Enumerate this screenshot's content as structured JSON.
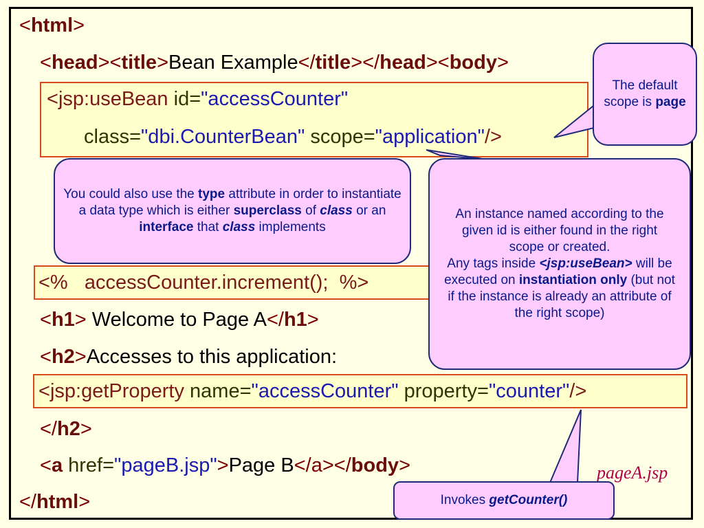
{
  "code": {
    "line1": {
      "open": "<",
      "tag": "html",
      "close": ">"
    },
    "line2": {
      "p1": "<",
      "head": "head",
      "p2": "><",
      "title": "title",
      "p3": ">",
      "text": "Bean Example",
      "p4": "</",
      "title2": "title",
      "p5": "></",
      "head2": "head",
      "p6": "><",
      "body": "body",
      "p7": ">"
    },
    "line3": {
      "p1": "<",
      "jsp": "jsp:useBean",
      "attr": "id=",
      "val": "\"accessCounter\""
    },
    "line4": {
      "attr1": "class=",
      "val1": "\"dbi.CounterBean\"",
      "attr2": "scope=",
      "val2": "\"application\"",
      "end": "/>"
    },
    "line5": {
      "text": "<%   accessCounter.increment();  %>"
    },
    "line6": {
      "p1": "<",
      "tag": "h1",
      "p2": ">",
      "text": " Welcome to Page A",
      "p3": "</",
      "tag2": "h1",
      "p4": ">"
    },
    "line7": {
      "p1": "<",
      "tag": "h2",
      "p2": ">",
      "text": "Accesses to this application:"
    },
    "line8": {
      "p1": "<",
      "jsp": "jsp:getProperty",
      "attr1": "name=",
      "val1": "\"accessCounter\"",
      "attr2": "property=",
      "val2": "\"counter\"",
      "end": "/>"
    },
    "line9": {
      "p1": "</",
      "tag": "h2",
      "p2": ">"
    },
    "line10": {
      "p1": "<",
      "tag": "a",
      "attr": " href=",
      "val": "\"pageB.jsp\"",
      "p2": ">",
      "text": "Page B",
      "p3": "</",
      "tag2": "a",
      "p4": "></",
      "tag3": "body",
      "p5": ">"
    },
    "line11": {
      "p1": "</",
      "tag": "html",
      "p2": ">"
    }
  },
  "callouts": {
    "scope": {
      "t1": "The default scope is ",
      "b1": "page"
    },
    "type": {
      "t1": "You could also use the ",
      "b1": "type",
      "t2": " attribute in order to instantiate a data type which is either ",
      "b2": "superclass",
      "t3": " of ",
      "b3": "class",
      "t4": " or an ",
      "b4": "interface",
      "t5": " that ",
      "b5": "class",
      "t6": " implements"
    },
    "instance": {
      "t1": "An instance named according to the given id is either found in the right scope or created.",
      "t2": "Any tags inside ",
      "b1": "<jsp:useBean>",
      "t3": " will be executed on ",
      "b2": "instantiation only",
      "t4": " (but not if the instance is already an attribute of the right scope)"
    },
    "invokes": {
      "t1": "Invokes ",
      "b1": "getCounter()"
    }
  },
  "filename": "pageA.jsp"
}
